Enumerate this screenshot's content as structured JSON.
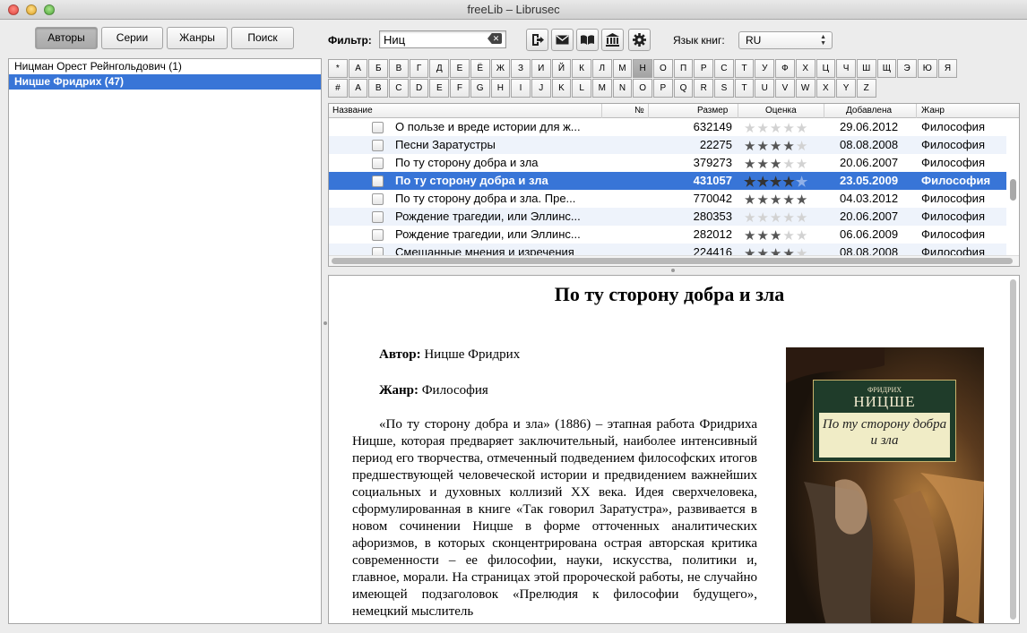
{
  "window": {
    "title": "freeLib – Librusec"
  },
  "nav": {
    "tabs": [
      "Авторы",
      "Серии",
      "Жанры",
      "Поиск"
    ]
  },
  "filter": {
    "label": "Фильтр:",
    "value": "Ниц"
  },
  "language": {
    "label": "Язык книг:",
    "value": "RU"
  },
  "alphabet": {
    "row1": [
      "*",
      "А",
      "Б",
      "В",
      "Г",
      "Д",
      "Е",
      "Ё",
      "Ж",
      "З",
      "И",
      "Й",
      "К",
      "Л",
      "М",
      "Н",
      "О",
      "П",
      "Р",
      "С",
      "Т",
      "У",
      "Ф",
      "Х",
      "Ц",
      "Ч",
      "Ш",
      "Щ",
      "Э",
      "Ю",
      "Я"
    ],
    "row2": [
      "#",
      "A",
      "B",
      "C",
      "D",
      "E",
      "F",
      "G",
      "H",
      "I",
      "J",
      "K",
      "L",
      "M",
      "N",
      "O",
      "P",
      "Q",
      "R",
      "S",
      "T",
      "U",
      "V",
      "W",
      "X",
      "Y",
      "Z"
    ],
    "active": "Н"
  },
  "authors": {
    "items": [
      "Ницман Орест Рейнгольдович (1)",
      "Ницше Фридрих (47)"
    ],
    "selected_index": 1
  },
  "books": {
    "columns": [
      "Название",
      "№",
      "Размер",
      "Оценка",
      "Добавлена",
      "Жанр"
    ],
    "rows": [
      {
        "title": "О пользе и вреде истории для ж...",
        "size": "632149",
        "rating": 0,
        "date": "29.06.2012",
        "genre": "Философия"
      },
      {
        "title": "Песни Заратустры",
        "size": "22275",
        "rating": 4,
        "date": "08.08.2008",
        "genre": "Философия"
      },
      {
        "title": "По ту сторону добра и зла",
        "size": "379273",
        "rating": 3,
        "date": "20.06.2007",
        "genre": "Философия"
      },
      {
        "title": "По ту сторону добра и зла",
        "size": "431057",
        "rating": 4,
        "date": "23.05.2009",
        "genre": "Философия"
      },
      {
        "title": "По ту сторону добра и зла. Пре...",
        "size": "770042",
        "rating": 5,
        "date": "04.03.2012",
        "genre": "Философия"
      },
      {
        "title": "Рождение трагедии, или Эллинс...",
        "size": "280353",
        "rating": 0,
        "date": "20.06.2007",
        "genre": "Философия"
      },
      {
        "title": "Рождение трагедии, или Эллинс...",
        "size": "282012",
        "rating": 3,
        "date": "06.06.2009",
        "genre": "Философия"
      },
      {
        "title": "Смешанные мнения и изречения",
        "size": "224416",
        "rating": 4,
        "date": "08.08.2008",
        "genre": "Философия"
      }
    ],
    "selected_index": 3
  },
  "details": {
    "title": "По ту сторону добра и зла",
    "author_label": "Автор:",
    "author": "Ницше Фридрих",
    "genre_label": "Жанр:",
    "genre": "Философия",
    "description": "«По ту сторону добра и зла» (1886) – этапная работа Фридриха Ницше, которая предваряет заключительный, наиболее интенсивный период его творчества, отмеченный подведением философских итогов предшествующей человеческой истории и предвидением важнейших социальных и духовных коллизий XX века. Идея сверхчеловека, сформулированная в книге «Так говорил Заратустра», развивается в новом сочинении Ницше в форме отточенных аналитических афоризмов, в которых сконцентрирована острая авторская критика современности – ее философии, науки, искусства, политики и, главное, морали. На страницах этой пророческой работы, не случайно имеющей подзаголовок «Прелюдия к философии будущего», немецкий мыслитель",
    "cover": {
      "author_small": "ФРИДРИХ",
      "author": "НИЦШЕ",
      "title": "По ту сторону добра и зла"
    }
  },
  "colors": {
    "selection": "#3875d7",
    "alt_row": "#eef3fb"
  }
}
